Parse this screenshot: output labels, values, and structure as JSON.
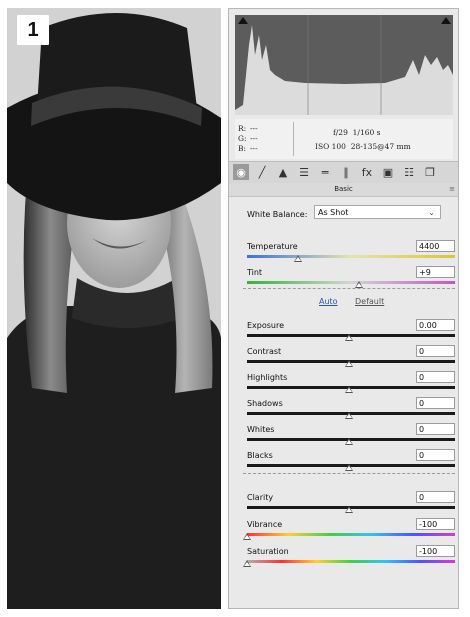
{
  "figure_number": "1",
  "readout": {
    "r_label": "R:",
    "g_label": "G:",
    "b_label": "B:",
    "r_value": "---",
    "g_value": "---",
    "b_value": "---",
    "aperture": "f/29",
    "shutter": "1/160 s",
    "iso": "ISO 100",
    "lens": "28-135@47 mm"
  },
  "toolbar": {
    "tabs": [
      {
        "icon": "aperture-icon",
        "glyph": "◉"
      },
      {
        "icon": "tone-curve-icon",
        "glyph": "╱"
      },
      {
        "icon": "detail-icon",
        "glyph": "▲"
      },
      {
        "icon": "hsl-icon",
        "glyph": "☰"
      },
      {
        "icon": "split-toning-icon",
        "glyph": "═"
      },
      {
        "icon": "lens-corrections-icon",
        "glyph": "∥"
      },
      {
        "icon": "effects-icon",
        "glyph": "fx"
      },
      {
        "icon": "camera-calibration-icon",
        "glyph": "▣"
      },
      {
        "icon": "presets-icon",
        "glyph": "☷"
      },
      {
        "icon": "snapshots-icon",
        "glyph": "❐"
      }
    ]
  },
  "section_title": "Basic",
  "white_balance": {
    "label": "White Balance:",
    "value": "As Shot"
  },
  "auto_label": "Auto",
  "default_label": "Default",
  "sliders": [
    {
      "label": "Temperature",
      "value": "4400",
      "position": 0.25,
      "track": "temperature"
    },
    {
      "label": "Tint",
      "value": "+9",
      "position": 0.55,
      "track": "tint"
    },
    {
      "label": "Exposure",
      "value": "0.00",
      "position": 0.5,
      "track": "gray"
    },
    {
      "label": "Contrast",
      "value": "0",
      "position": 0.5,
      "track": "gray"
    },
    {
      "label": "Highlights",
      "value": "0",
      "position": 0.5,
      "track": "gray"
    },
    {
      "label": "Shadows",
      "value": "0",
      "position": 0.5,
      "track": "gray"
    },
    {
      "label": "Whites",
      "value": "0",
      "position": 0.5,
      "track": "gray"
    },
    {
      "label": "Blacks",
      "value": "0",
      "position": 0.5,
      "track": "gray"
    },
    {
      "label": "Clarity",
      "value": "0",
      "position": 0.5,
      "track": "gray"
    },
    {
      "label": "Vibrance",
      "value": "-100",
      "position": 0.0,
      "track": "vibrance"
    },
    {
      "label": "Saturation",
      "value": "-100",
      "position": 0.0,
      "track": "saturation"
    }
  ],
  "colors": {
    "panel_bg": "#e9e9e9",
    "histogram_bg": "#5c5c5c",
    "histogram_fill": "#dcdcdc",
    "link_blue": "#2d54b2"
  }
}
